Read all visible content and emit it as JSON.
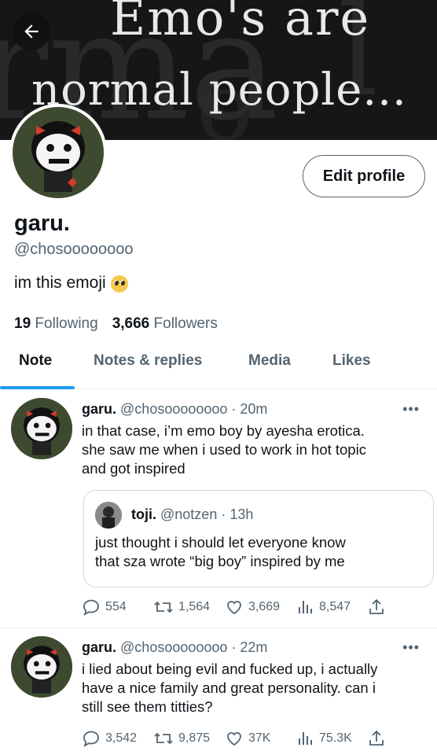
{
  "banner": {
    "line1": "Emo's are",
    "line2": "normal people..."
  },
  "header": {
    "back_icon": "arrow-left-icon",
    "edit_profile_label": "Edit profile"
  },
  "profile": {
    "display_name": "garu.",
    "handle": "@chosoooooooo",
    "bio": "im this emoji",
    "bio_emoji": "pleading-face-icon",
    "following_count": "19",
    "following_label": "Following",
    "followers_count": "3,666",
    "followers_label": "Followers"
  },
  "tabs": [
    {
      "label": "Note",
      "active": true
    },
    {
      "label": "Notes & replies",
      "active": false
    },
    {
      "label": "Media",
      "active": false
    },
    {
      "label": "Likes",
      "active": false
    }
  ],
  "colors": {
    "accent": "#1d9bf0",
    "text_primary": "#0f1419",
    "text_secondary": "#536471"
  },
  "tweets": [
    {
      "name": "garu.",
      "meta": "@chosoooooooo · 20m",
      "text": "in that case, i’m emo boy by ayesha erotica.\nshe saw me when i used to work in hot topic\nand got inspired",
      "quote": {
        "name": "toji.",
        "meta": "@notzen · 13h",
        "text": "just thought i should let everyone know\nthat sza wrote “big boy” inspired by me"
      },
      "replies": "554",
      "retweets": "1,564",
      "likes": "3,669",
      "views": "8,547"
    },
    {
      "name": "garu.",
      "meta": "@chosoooooooo · 22m",
      "text": "i lied about being evil and fucked up, i actually\nhave a nice family and great personality. can i\nstill see them titties?",
      "replies": "3,542",
      "retweets": "9,875",
      "likes": "37K",
      "views": "75.3K"
    }
  ]
}
